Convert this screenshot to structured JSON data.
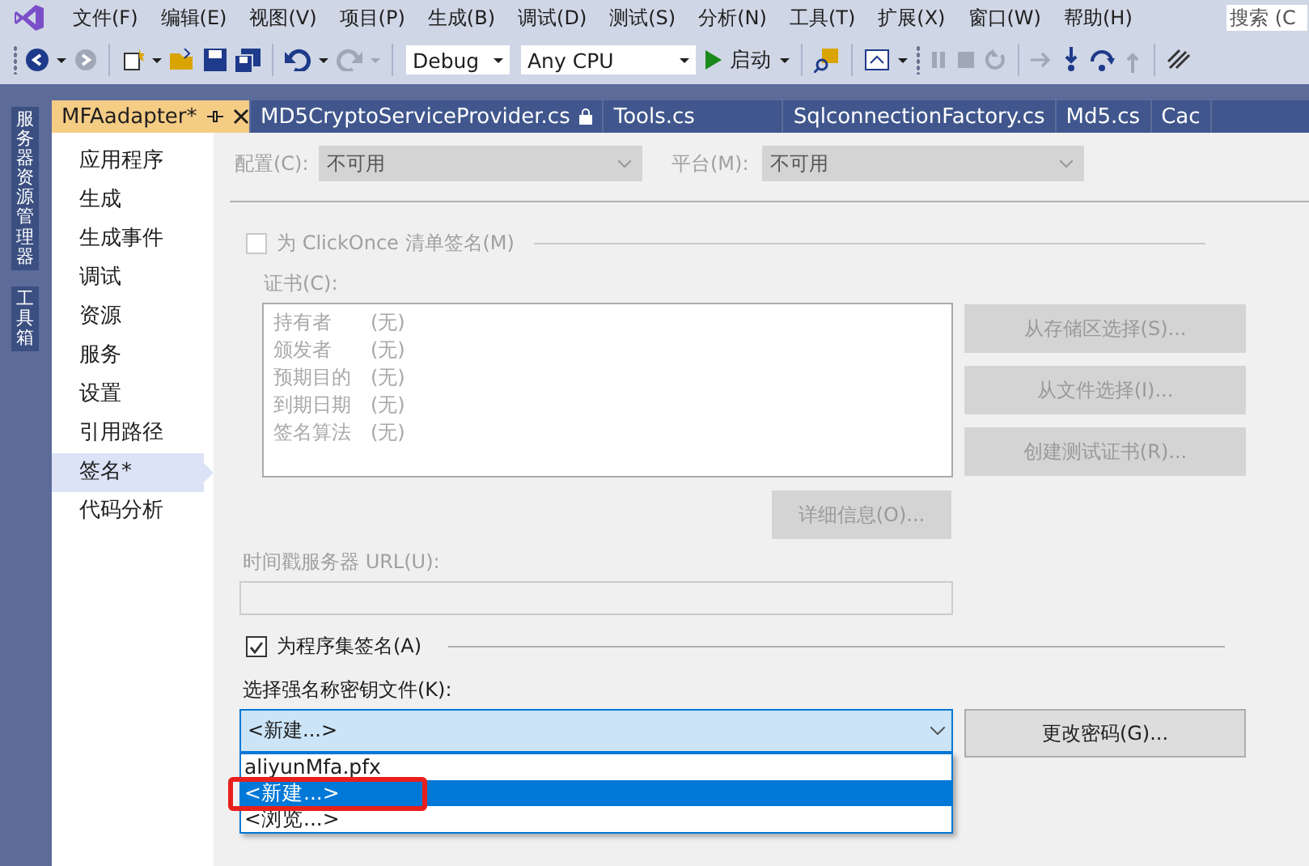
{
  "menu": [
    {
      "label": "文件(F)"
    },
    {
      "label": "编辑(E)"
    },
    {
      "label": "视图(V)"
    },
    {
      "label": "项目(P)"
    },
    {
      "label": "生成(B)"
    },
    {
      "label": "调试(D)"
    },
    {
      "label": "测试(S)"
    },
    {
      "label": "分析(N)"
    },
    {
      "label": "工具(T)"
    },
    {
      "label": "扩展(X)"
    },
    {
      "label": "窗口(W)"
    },
    {
      "label": "帮助(H)"
    }
  ],
  "search": {
    "placeholder": "搜索 (C"
  },
  "toolbar": {
    "configuration": "Debug",
    "platform": "Any CPU",
    "start": "启动"
  },
  "side_strip": [
    {
      "label": "服务器资源管理器"
    },
    {
      "label": "工具箱"
    }
  ],
  "tabs": [
    {
      "label": "MFAadapter*",
      "selected": true,
      "locked": false
    },
    {
      "label": "MD5CryptoServiceProvider.cs",
      "selected": false,
      "locked": true
    },
    {
      "label": "Tools.cs",
      "selected": false,
      "locked": false
    },
    {
      "label": "SqlconnectionFactory.cs",
      "selected": false,
      "locked": false
    },
    {
      "label": "Md5.cs",
      "selected": false,
      "locked": false
    },
    {
      "label": "Cac",
      "selected": false,
      "locked": false
    }
  ],
  "nav": [
    {
      "label": "应用程序",
      "selected": false
    },
    {
      "label": "生成",
      "selected": false
    },
    {
      "label": "生成事件",
      "selected": false
    },
    {
      "label": "调试",
      "selected": false
    },
    {
      "label": "资源",
      "selected": false
    },
    {
      "label": "服务",
      "selected": false
    },
    {
      "label": "设置",
      "selected": false
    },
    {
      "label": "引用路径",
      "selected": false
    },
    {
      "label": "签名*",
      "selected": true
    },
    {
      "label": "代码分析",
      "selected": false
    }
  ],
  "configuration": {
    "label": "配置(C):",
    "value": "不可用",
    "disabled": true
  },
  "platform": {
    "label": "平台(M):",
    "value": "不可用",
    "disabled": true
  },
  "clickonce": {
    "label": "为 ClickOnce 清单签名(M)",
    "checked": false,
    "disabled": true
  },
  "certificate": {
    "label": "证书(C):",
    "fields": [
      {
        "name": "持有者",
        "value": "(无)"
      },
      {
        "name": "颁发者",
        "value": "(无)"
      },
      {
        "name": "预期目的",
        "value": "(无)"
      },
      {
        "name": "到期日期",
        "value": "(无)"
      },
      {
        "name": "签名算法",
        "value": "(无)"
      }
    ]
  },
  "certificate_buttons": [
    {
      "label": "从存储区选择(S)...",
      "disabled": true
    },
    {
      "label": "从文件选择(I)...",
      "disabled": true
    },
    {
      "label": "创建测试证书(R)...",
      "disabled": true
    }
  ],
  "details_button": {
    "label": "详细信息(O)...",
    "disabled": true
  },
  "timestamp": {
    "label": "时间戳服务器 URL(U):",
    "disabled": true
  },
  "sign_assembly": {
    "label": "为程序集签名(A)",
    "checked": true,
    "disabled": false
  },
  "key_file": {
    "label": "选择强名称密钥文件(K):",
    "value": "<新建...>",
    "expanded": true,
    "options": [
      {
        "label": "aliyunMfa.pfx",
        "selected": false,
        "annotated": false
      },
      {
        "label": "<新建...>",
        "selected": true,
        "annotated": true
      },
      {
        "label": "<浏览...>",
        "selected": false,
        "annotated": false
      }
    ]
  },
  "change_password_button": {
    "label": "更改密码(G)...",
    "disabled": false
  }
}
